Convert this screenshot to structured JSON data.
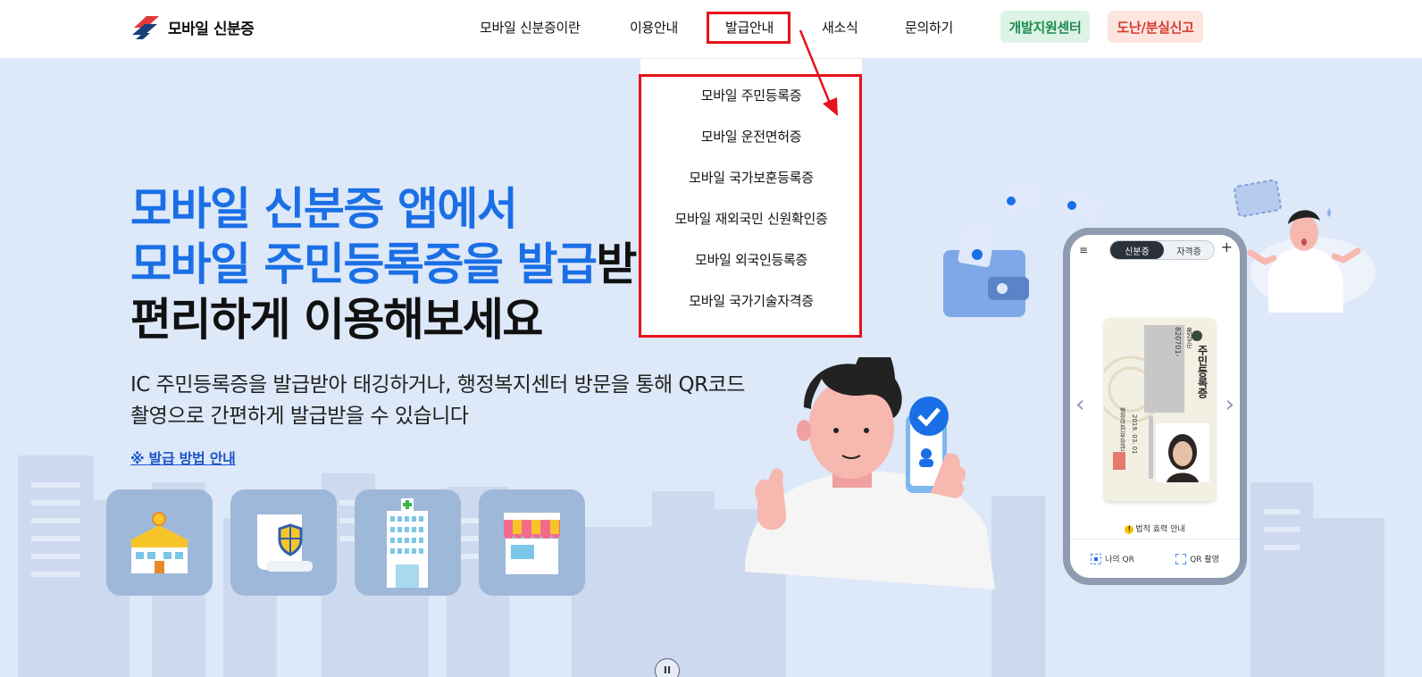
{
  "header": {
    "logo_text": "모바일 신분증",
    "nav": [
      "모바일 신분증이란",
      "이용안내",
      "발급안내",
      "새소식",
      "문의하기"
    ],
    "dev_center": "개발지원센터",
    "lost_report": "도난/분실신고"
  },
  "dropdown": {
    "items": [
      "모바일 주민등록증",
      "모바일 운전면허증",
      "모바일 국가보훈등록증",
      "모바일 재외국민 신원확인증",
      "모바일 외국인등록증",
      "모바일 국가기술자격증"
    ]
  },
  "hero": {
    "line1": "모바일 신분증 앱에서",
    "line2_blue": "모바일 주민등록증을 발급",
    "line2_dark": "받",
    "line3": "편리하게 이용해보세요",
    "sub1": "IC 주민등록증을 발급받아 태깅하거나, 행정복지센터 방문을 통해 QR코드",
    "sub2": "촬영으로 간편하게 발급받을 수 있습니다",
    "guide_link": "※ 발급 방법 안내"
  },
  "phone": {
    "tab_active": "신분증",
    "tab_inactive": "자격증",
    "menu_icon": "≡",
    "plus_icon": "+",
    "prev_icon": "‹",
    "next_icon": "›",
    "notice": "법적 효력 안내",
    "notice_icon": "!",
    "my_qr": "나의 QR",
    "qr_scan": "QR 촬영",
    "card_title": "주민등록증",
    "card_name": "홍길순",
    "card_number": "820701-",
    "card_issuer": "행정안전부장관",
    "card_date": "2019. 03. 01"
  },
  "pause_icon": "II",
  "colors": {
    "accent_blue": "#1b6fe6",
    "highlight_red": "#e8111b",
    "dev_green": "#1d8a4e",
    "report_red": "#d63a2e",
    "hero_bg": "#dde8f8"
  }
}
